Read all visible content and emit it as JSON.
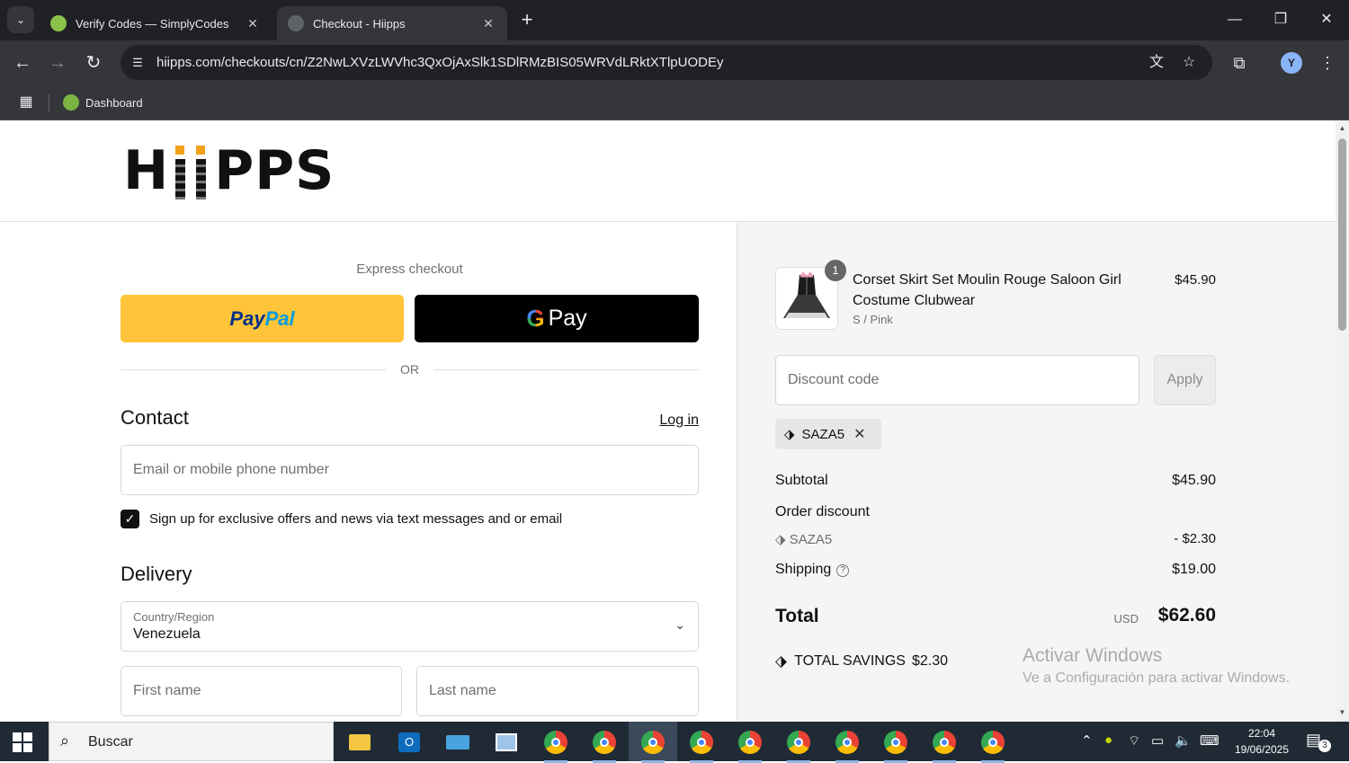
{
  "browser": {
    "tabs": [
      {
        "title": "Verify Codes — SimplyCodes",
        "active": false,
        "favicon_color": "#8bc34a"
      },
      {
        "title": "Checkout - Hiipps",
        "active": true,
        "favicon_color": "#5f6368"
      }
    ],
    "url": "hiipps.com/checkouts/cn/Z2NwLXVzLWVhc3QxOjAxSlk1SDlRMzBIS05WRVdLRktXTlpUODEy",
    "bookmark": "Dashboard",
    "profile_initial": "Y"
  },
  "store": {
    "logo_text_prefix": "H",
    "logo_text_suffix": "PPS",
    "logo_accent": "#f0a21a"
  },
  "checkout": {
    "express_title": "Express checkout",
    "paypal_pay": "Pay",
    "paypal_pal": "Pal",
    "gpay_g": "G",
    "gpay_label": "Pay",
    "or": "OR",
    "contact_title": "Contact",
    "login": "Log in",
    "email_placeholder": "Email or mobile phone number",
    "signup_label": "Sign up for exclusive offers and news via text messages and or email",
    "signup_checked": true,
    "delivery_title": "Delivery",
    "country_label": "Country/Region",
    "country_value": "Venezuela",
    "first_name_placeholder": "First name",
    "last_name_placeholder": "Last name"
  },
  "summary": {
    "product": {
      "quantity": "1",
      "name": "Corset Skirt Set Moulin Rouge Saloon Girl Costume Clubwear",
      "variant": "S / Pink",
      "price": "$45.90"
    },
    "discount_placeholder": "Discount code",
    "apply": "Apply",
    "applied_code": "SAZA5",
    "subtotal_label": "Subtotal",
    "subtotal": "$45.90",
    "order_discount_label": "Order discount",
    "discount_code": "SAZA5",
    "discount_amount": "- $2.30",
    "shipping_label": "Shipping",
    "shipping": "$19.00",
    "total_label": "Total",
    "currency": "USD",
    "total": "$62.60",
    "savings_label": "TOTAL SAVINGS",
    "savings": "$2.30"
  },
  "watermark": {
    "line1": "Activar Windows",
    "line2": "Ve a Configuración para activar Windows."
  },
  "taskbar": {
    "search": "Buscar",
    "time": "22:04",
    "date": "19/06/2025",
    "notifications": "3",
    "chrome_profiles": [
      "",
      "Y",
      "Y",
      "",
      "J",
      "J",
      "R",
      "Y",
      "Y",
      "J"
    ]
  }
}
